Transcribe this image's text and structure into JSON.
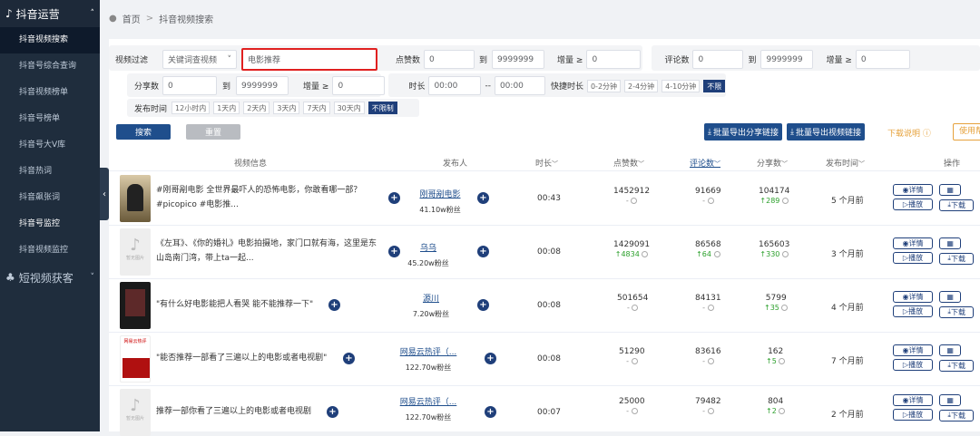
{
  "sidebar": {
    "section1": "抖音运营",
    "items": [
      "抖音视频搜索",
      "抖音号综合查询",
      "抖音视频榜单",
      "抖音号榜单",
      "抖音号大V库",
      "抖音热词",
      "抖音飙张词",
      "抖音号监控",
      "抖音视频监控"
    ],
    "section2": "短视频获客"
  },
  "breadcrumb": {
    "home": "首页",
    "sep": ">",
    "current": "抖音视频搜索"
  },
  "filters": {
    "video_filter_label": "视频过滤",
    "mode_select": "关键词查视频",
    "keyword_value": "电影推荐",
    "likes_label": "点赞数",
    "likes_min": "0",
    "to1": "到",
    "likes_max": "9999999",
    "likes_inc_label": "增量 ≥",
    "likes_inc": "0",
    "comments_label": "评论数",
    "comments_min": "0",
    "to2": "到",
    "comments_max": "9999999",
    "comments_inc_label": "增量 ≥",
    "comments_inc": "0",
    "shares_label": "分享数",
    "shares_min": "0",
    "to3": "到",
    "shares_max": "9999999",
    "shares_inc_label": "增量 ≥",
    "shares_inc": "0",
    "duration_label": "时长",
    "dur_start": "00:00",
    "dash": "--",
    "dur_end": "00:00",
    "quick_dur_label": "快捷时长",
    "quick_dur": [
      "0-2分钟",
      "2-4分钟",
      "4-10分钟",
      "不限"
    ],
    "publish_label": "发布时间",
    "publish": [
      "12小时内",
      "1天内",
      "2天内",
      "3天内",
      "7天内",
      "30天内",
      "不限制"
    ]
  },
  "actions": {
    "search": "搜索",
    "reset": "重置",
    "export_share": "批量导出分享链接",
    "export_video": "批量导出视频链接",
    "download_help": "下载说明",
    "usage": "使用帮"
  },
  "table": {
    "headers": {
      "video": "视频信息",
      "publisher": "发布人",
      "duration": "时长",
      "likes": "点赞数",
      "comments": "评论数",
      "shares": "分享数",
      "pubtime": "发布时间",
      "ops": "操作"
    },
    "op_labels": {
      "detail": "详情",
      "play": "播放",
      "download": "下载"
    },
    "rows": [
      {
        "text": "#刚哥剐电影 全世界最吓人的恐怖电影，你敢看哪一部？#picopico #电影推...",
        "publisher": "刚哥剐电影",
        "fans": "41.10w粉丝",
        "duration": "00:43",
        "likes": "1452912",
        "likes_sub": "-",
        "comments": "91669",
        "comments_sub": "-",
        "shares": "104174",
        "shares_sub": "289",
        "pubtime": "5 个月前"
      },
      {
        "text": "《左耳》、《你的婚礼》电影拍摄地，家门口就有海，这里是东山岛南门湾，带上ta一起...",
        "publisher": "乌乌",
        "fans": "45.20w粉丝",
        "duration": "00:08",
        "likes": "1429091",
        "likes_sub": "4834",
        "comments": "86568",
        "comments_sub": "64",
        "shares": "165603",
        "shares_sub": "330",
        "pubtime": "3 个月前"
      },
      {
        "text": "\"有什么好电影能把人看哭 能不能推荐一下\"",
        "publisher": "源川",
        "fans": "7.20w粉丝",
        "duration": "00:08",
        "likes": "501654",
        "likes_sub": "-",
        "comments": "84131",
        "comments_sub": "-",
        "shares": "5799",
        "shares_sub": "35",
        "pubtime": "4 个月前"
      },
      {
        "text": "\"能否推荐一部看了三遍以上的电影或者电视剧\"",
        "publisher": "网易云热评（...",
        "fans": "122.70w粉丝",
        "duration": "00:08",
        "likes": "51290",
        "likes_sub": "-",
        "comments": "83616",
        "comments_sub": "-",
        "shares": "162",
        "shares_sub": "5",
        "pubtime": "7 个月前"
      },
      {
        "text": "推荐一部你看了三遍以上的电影或者电视剧",
        "publisher": "网易云热评（...",
        "fans": "122.70w粉丝",
        "duration": "00:07",
        "likes": "25000",
        "likes_sub": "-",
        "comments": "79482",
        "comments_sub": "-",
        "shares": "804",
        "shares_sub": "2",
        "pubtime": "2 个月前"
      }
    ]
  },
  "thumb_labels": {
    "row4": "网易云热评",
    "tiktok_caption": "暂无图片"
  },
  "colors": {
    "sidebar": "#1f2d3d",
    "primary": "#1f4e8c",
    "highlight_border": "#e02020",
    "increase": "#2ca02c"
  }
}
